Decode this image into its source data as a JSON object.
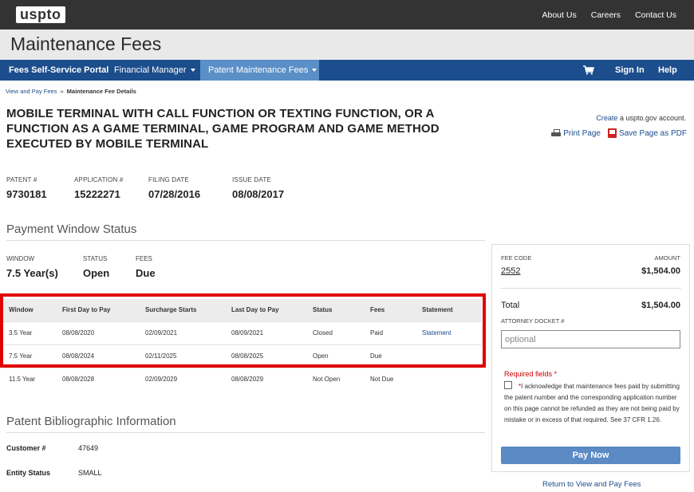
{
  "header": {
    "logo": "uspto",
    "links": [
      "About Us",
      "Careers",
      "Contact Us"
    ],
    "page_title": "Maintenance Fees"
  },
  "nav": {
    "portal": "Fees Self-Service Portal",
    "financial": "Financial Manager",
    "patent_fees": "Patent Maintenance Fees",
    "cart_icon": "shopping-cart-icon",
    "sign_in": "Sign In",
    "help": "Help"
  },
  "breadcrumb": {
    "parent": "View and Pay Fees",
    "separator": "»",
    "current": "Maintenance Fee Details"
  },
  "patent": {
    "title": "MOBILE TERMINAL WITH CALL FUNCTION OR TEXTING FUNCTION, OR A FUNCTION AS A GAME TERMINAL, GAME PROGRAM AND GAME METHOD EXECUTED BY MOBILE TERMINAL",
    "fields": [
      {
        "label": "PATENT #",
        "value": "9730181"
      },
      {
        "label": "APPLICATION #",
        "value": "15222271"
      },
      {
        "label": "FILING DATE",
        "value": "07/28/2016"
      },
      {
        "label": "ISSUE DATE",
        "value": "08/08/2017"
      }
    ]
  },
  "account": {
    "create": "Create",
    "suffix": "a uspto.gov account.",
    "print": "Print Page",
    "pdf": "Save Page as PDF"
  },
  "payment_window": {
    "heading": "Payment Window Status",
    "summary": [
      {
        "label": "WINDOW",
        "value": "7.5 Year(s)"
      },
      {
        "label": "STATUS",
        "value": "Open"
      },
      {
        "label": "FEES",
        "value": "Due"
      }
    ],
    "columns": [
      "Window",
      "First Day to Pay",
      "Surcharge Starts",
      "Last Day to Pay",
      "Status",
      "Fees",
      "Statement"
    ],
    "rows": [
      [
        "3.5 Year",
        "08/08/2020",
        "02/09/2021",
        "08/09/2021",
        "Closed",
        "Paid",
        "Statement"
      ],
      [
        "7.5 Year",
        "08/08/2024",
        "02/11/2025",
        "08/08/2025",
        "Open",
        "Due",
        ""
      ],
      [
        "11.5 Year",
        "08/08/2028",
        "02/09/2029",
        "08/08/2029",
        "Not Open",
        "Not Due",
        ""
      ]
    ]
  },
  "biblio": {
    "heading": "Patent Bibliographic Information",
    "items": [
      {
        "label": "Customer #",
        "value": "47649"
      },
      {
        "label": "Entity Status",
        "value": "SMALL"
      }
    ]
  },
  "sidebar": {
    "fee_code_label": "FEE CODE",
    "amount_label": "AMOUNT",
    "fee_code": "2552",
    "fee_amount": "$1,504.00",
    "total_label": "Total",
    "total_amount": "$1,504.00",
    "docket_label": "ATTORNEY DOCKET #",
    "docket_placeholder": "optional",
    "required": "Required fields *",
    "ack_star": "*",
    "ack_text": "I acknowledge that maintenance fees paid by submitting the patent number and the corresponding application number on this page cannot be refunded as they are not being paid by mistake or in excess of that required. See 37 CFR 1.26.",
    "pay_button": "Pay Now",
    "return_link": "Return to View and Pay Fees"
  }
}
